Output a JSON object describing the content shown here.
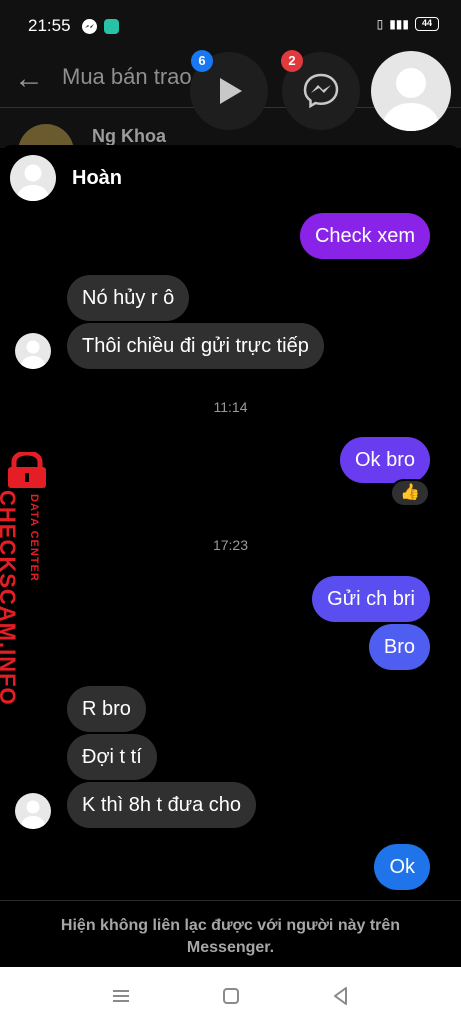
{
  "status_bar": {
    "time": "21:55",
    "battery": "44"
  },
  "background": {
    "title": "Mua bán trao đổi uy",
    "row_name": "Ng Khoa"
  },
  "chat_heads": {
    "play_badge": "6",
    "messenger_badge": "2"
  },
  "conversation": {
    "contact_name": "Hoàn",
    "messages": [
      {
        "dir": "out",
        "text": "Check xem"
      },
      {
        "dir": "in",
        "text": "Nó hủy r ô"
      },
      {
        "dir": "in",
        "text": "Thôi chiều đi gửi trực tiếp"
      },
      {
        "type": "time",
        "text": "11:14"
      },
      {
        "dir": "out",
        "text": "Ok bro"
      },
      {
        "type": "time",
        "text": "17:23"
      },
      {
        "dir": "out",
        "text": "Gửi ch bri"
      },
      {
        "dir": "out",
        "text": "Bro"
      },
      {
        "dir": "in",
        "text": "R bro"
      },
      {
        "dir": "in",
        "text": "Đợi t tí"
      },
      {
        "dir": "in",
        "text": "K thì 8h t đưa cho"
      },
      {
        "dir": "out",
        "text": "Ok"
      }
    ],
    "reaction": "👍"
  },
  "watermark": {
    "brand": "CHECKSCAM.INFO",
    "sub": "DATA CENTER"
  },
  "footer": {
    "notice": "Hiện không liên lạc được với người này trên Messenger."
  },
  "colors": {
    "outgoing_1": "#8a23e8",
    "outgoing_2": "#6a3cf0",
    "outgoing_3": "#5a4ef0",
    "outgoing_4": "#1e74e8",
    "incoming": "#303030",
    "watermark": "#e51e25"
  }
}
